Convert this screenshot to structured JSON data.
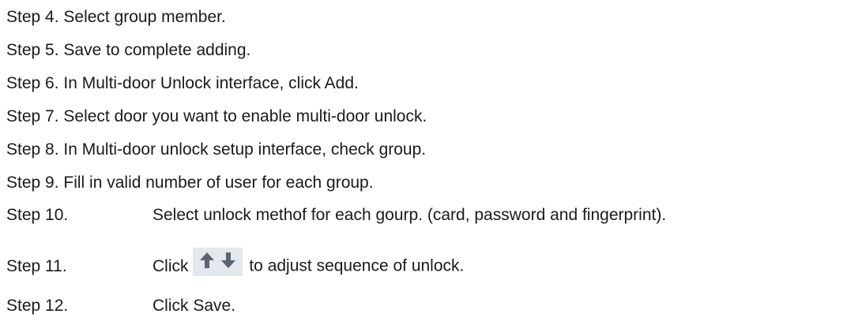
{
  "steps": [
    {
      "text": "Step 4. Select group member."
    },
    {
      "text": "Step 5. Save to complete adding."
    },
    {
      "text": "Step 6. In Multi-door Unlock interface, click Add."
    },
    {
      "text": "Step 7. Select door you want to enable multi-door unlock."
    },
    {
      "text": "Step 8. In Multi-door unlock setup interface, check group."
    },
    {
      "text": "Step 9. Fill in valid number of user for each group."
    }
  ],
  "step10": {
    "num": "Step 10.",
    "text": "Select unlock methof for each gourp. (card, password and fingerprint)."
  },
  "step11": {
    "num": "Step 11.",
    "pre": "Click",
    "post": "to adjust sequence of unlock.",
    "icons": [
      "arrow-up-icon",
      "arrow-down-icon"
    ],
    "icon_color": "#5a6470",
    "icon_bg": "#e3e8ee"
  },
  "step12": {
    "num": "Step 12.",
    "text": "Click Save."
  }
}
